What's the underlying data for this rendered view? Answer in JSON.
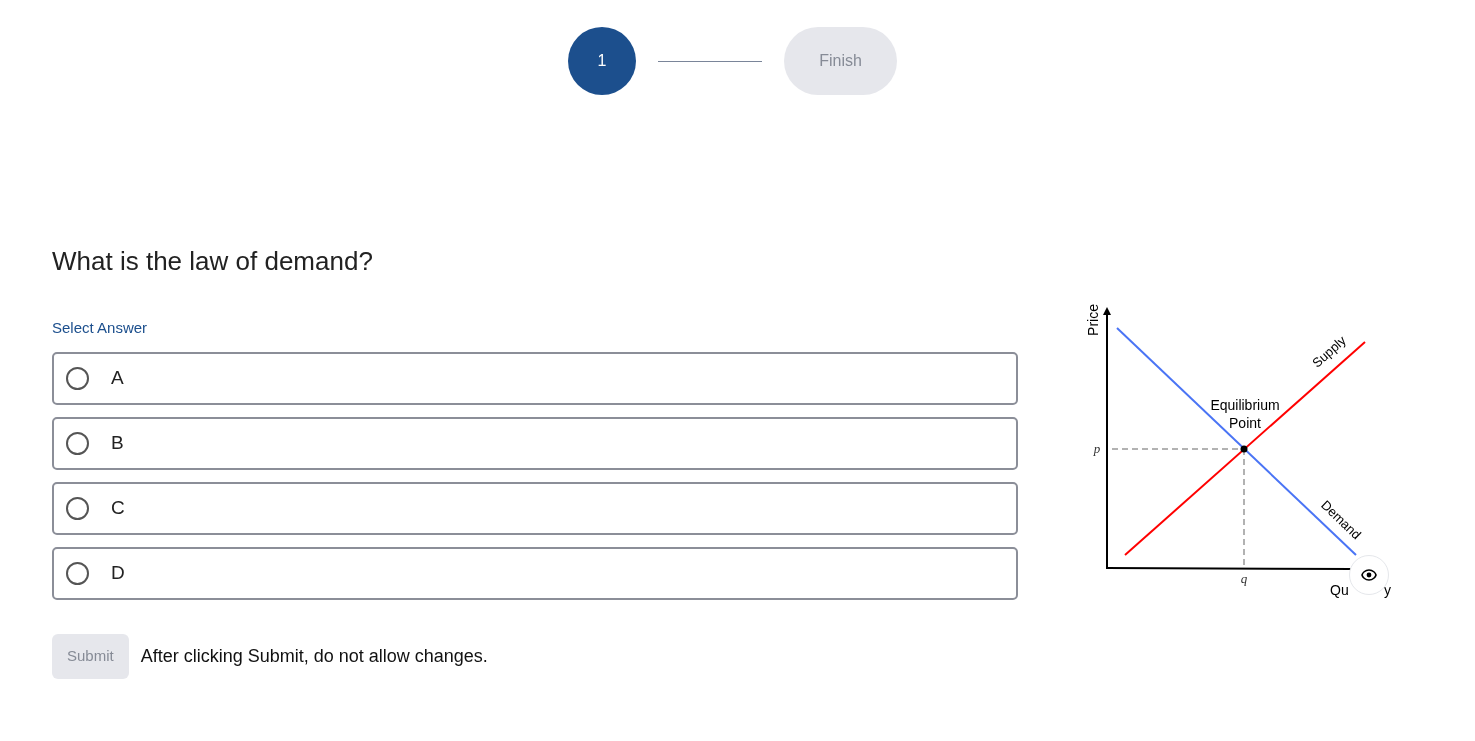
{
  "stepper": {
    "steps": [
      {
        "label": "1",
        "selected": true
      },
      {
        "label": "Finish",
        "selected": false
      }
    ]
  },
  "question": {
    "text": "What is the law of demand?",
    "prompt": "Select Answer",
    "options": [
      {
        "label": "A",
        "selected": false
      },
      {
        "label": "B",
        "selected": false
      },
      {
        "label": "C",
        "selected": false
      },
      {
        "label": "D",
        "selected": false
      }
    ]
  },
  "submit": {
    "label": "Submit",
    "disabled": true
  },
  "note": "After clicking Submit, do not allow changes.",
  "diagram": {
    "y_axis": "Price",
    "x_axis_parts": [
      "Qu",
      "y"
    ],
    "supply": "Supply",
    "demand": "Demand",
    "equilibrium": [
      "Equilibrium",
      "Point"
    ],
    "p": "p",
    "q": "q"
  }
}
